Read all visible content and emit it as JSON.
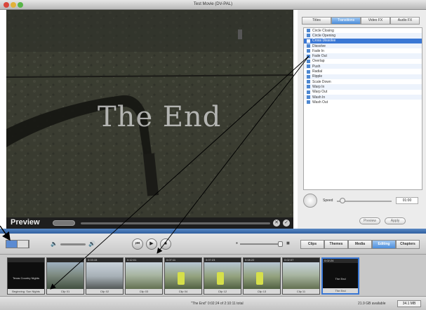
{
  "window": {
    "title": "Test Movie (DV-PAL)"
  },
  "preview": {
    "overlay_title": "The End",
    "label": "Preview"
  },
  "panel": {
    "tabs": [
      {
        "label": "Titles",
        "active": false
      },
      {
        "label": "Transitions",
        "active": true
      },
      {
        "label": "Video FX",
        "active": false
      },
      {
        "label": "Audio FX",
        "active": false
      }
    ],
    "transitions": [
      "Circle Closing",
      "Circle Opening",
      "Cross Dissolve",
      "Dissolve",
      "Fade In",
      "Fade Out",
      "Overlap",
      "Push",
      "Radial",
      "Ripple",
      "Scale Down",
      "Warp In",
      "Warp Out",
      "Wash In",
      "Wash Out"
    ],
    "selected_transition": "Cross Dissolve",
    "speed_label": "Speed",
    "speed_value": "01:00",
    "speed_level": 0.1,
    "preview_button": "Preview",
    "apply_button": "Apply"
  },
  "toolbar": {
    "modes": [
      {
        "label": "Clips",
        "active": false
      },
      {
        "label": "Themes",
        "active": false
      },
      {
        "label": "Media",
        "active": false
      },
      {
        "label": "Editing",
        "active": true
      },
      {
        "label": "Chapters",
        "active": false
      }
    ]
  },
  "timeline": {
    "clips": [
      {
        "timecode": "",
        "name": "Beginning: Sun Nights",
        "title": "Texas Country Nights",
        "scene": "dark"
      },
      {
        "timecode": "",
        "name": "Clip 01",
        "title": "",
        "scene": "people"
      },
      {
        "timecode": "0:03:15",
        "name": "Clip 02",
        "title": "",
        "scene": "car"
      },
      {
        "timecode": "0:12:01",
        "name": "Clip 03",
        "title": "",
        "scene": "field"
      },
      {
        "timecode": "0:07:11",
        "name": "Clip 04",
        "title": "",
        "scene": "vest"
      },
      {
        "timecode": "0:07:23",
        "name": "Clip 12",
        "title": "",
        "scene": "vest"
      },
      {
        "timecode": "0:08:22",
        "name": "Clip 13",
        "title": "",
        "scene": "vest"
      },
      {
        "timecode": "0:02:07",
        "name": "Clip 11",
        "title": "",
        "scene": "field"
      },
      {
        "timecode": "0:02:24",
        "name": "The End",
        "title": "The End",
        "scene": "dark",
        "selected": true
      }
    ]
  },
  "status": {
    "text": "\"The End\"  0:02:24 of 2:10:11 total",
    "disk": "21.9 GB available",
    "button": "34.1 MB"
  },
  "colors": {
    "accent": "#4c8edc",
    "selection": "#3a77d4",
    "dropbar": "#2f5fa0"
  }
}
